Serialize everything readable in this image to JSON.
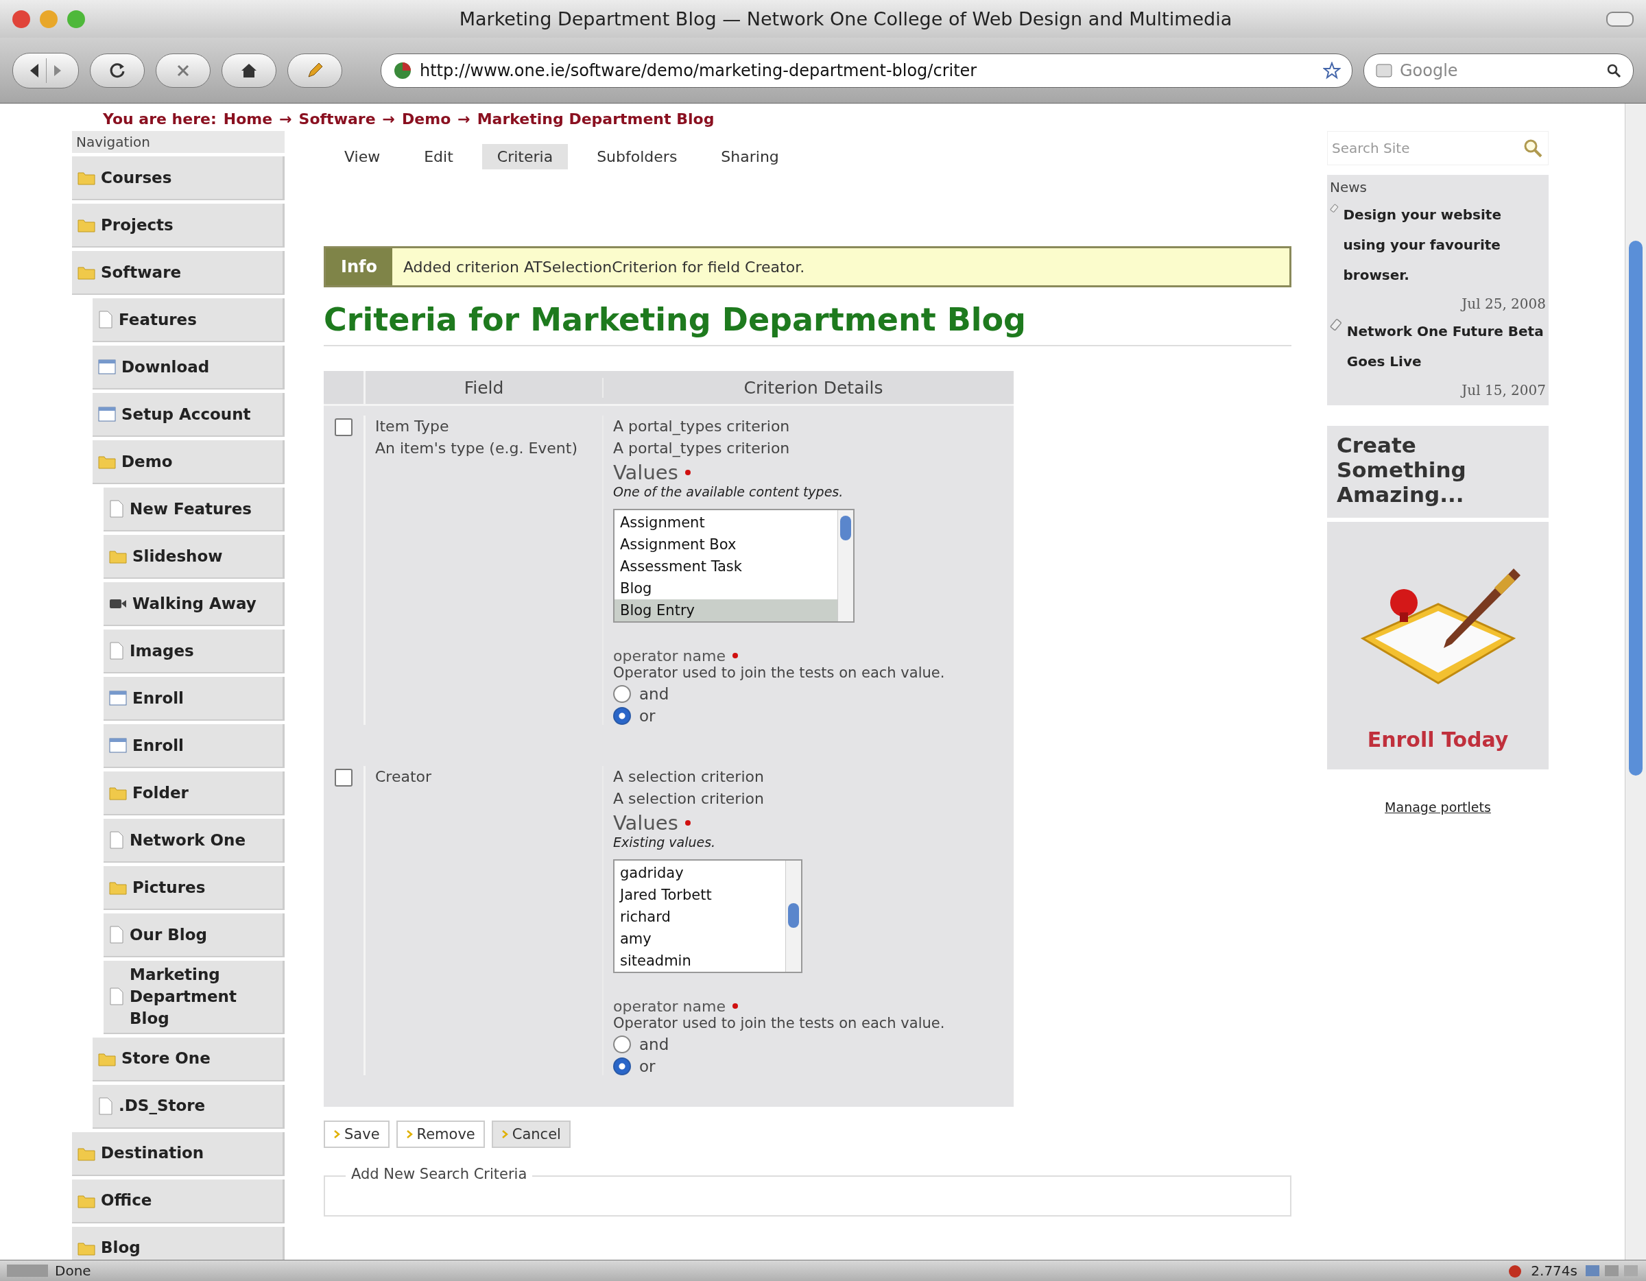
{
  "window": {
    "title": "Marketing Department Blog — Network One College of Web Design and Multimedia"
  },
  "toolbar": {
    "url": "http://www.one.ie/software/demo/marketing-department-blog/criter",
    "search_placeholder": "Google"
  },
  "breadcrumb": {
    "label": "You are here:",
    "separator": "→",
    "items": [
      "Home",
      "Software",
      "Demo",
      "Marketing Department Blog"
    ]
  },
  "navigation": {
    "title": "Navigation",
    "items": [
      {
        "label": "Courses",
        "kind": "folder"
      },
      {
        "label": "Projects",
        "kind": "folder"
      },
      {
        "label": "Software",
        "kind": "folder",
        "children": [
          {
            "label": "Features",
            "kind": "page"
          },
          {
            "label": "Download",
            "kind": "window"
          },
          {
            "label": "Setup Account",
            "kind": "window"
          },
          {
            "label": "Demo",
            "kind": "folder",
            "children": [
              {
                "label": "New Features",
                "kind": "page"
              },
              {
                "label": "Slideshow",
                "kind": "folder"
              },
              {
                "label": "Walking Away",
                "kind": "video"
              },
              {
                "label": "Images",
                "kind": "page"
              },
              {
                "label": "Enroll",
                "kind": "window"
              },
              {
                "label": "Enroll",
                "kind": "window"
              },
              {
                "label": "Folder",
                "kind": "folder"
              },
              {
                "label": "Network One",
                "kind": "page"
              },
              {
                "label": "Pictures",
                "kind": "folder"
              },
              {
                "label": "Our Blog",
                "kind": "page"
              },
              {
                "label": "Marketing Department Blog",
                "kind": "page"
              }
            ]
          },
          {
            "label": "Store One",
            "kind": "folder"
          },
          {
            "label": ".DS_Store",
            "kind": "page"
          }
        ]
      },
      {
        "label": "Destination",
        "kind": "folder"
      },
      {
        "label": "Office",
        "kind": "folder"
      },
      {
        "label": "Blog",
        "kind": "folder"
      }
    ]
  },
  "tabs": [
    {
      "label": "View",
      "selected": false
    },
    {
      "label": "Edit",
      "selected": false
    },
    {
      "label": "Criteria",
      "selected": true
    },
    {
      "label": "Subfolders",
      "selected": false
    },
    {
      "label": "Sharing",
      "selected": false
    }
  ],
  "message": {
    "type": "Info",
    "text": "Added criterion ATSelectionCriterion for field Creator."
  },
  "heading": "Criteria for Marketing Department Blog",
  "criteria_table": {
    "columns": [
      "Field",
      "Criterion Details"
    ],
    "rows": [
      {
        "checked": false,
        "field": "Item Type",
        "field_description": "An item's type (e.g. Event)",
        "details": [
          "A portal_types criterion",
          "A portal_types criterion"
        ],
        "values": {
          "label": "Values",
          "description": "One of the available content types.",
          "options": [
            {
              "label": "Assignment",
              "selected": false
            },
            {
              "label": "Assignment Box",
              "selected": false
            },
            {
              "label": "Assessment Task",
              "selected": false
            },
            {
              "label": "Blog",
              "selected": false
            },
            {
              "label": "Blog Entry",
              "selected": true
            }
          ]
        },
        "operator": {
          "label": "operator name",
          "description": "Operator used to join the tests on each value.",
          "options": [
            {
              "label": "and",
              "selected": false
            },
            {
              "label": "or",
              "selected": true
            }
          ]
        }
      },
      {
        "checked": false,
        "field": "Creator",
        "details": [
          "A selection criterion",
          "A selection criterion"
        ],
        "values": {
          "label": "Values",
          "description": "Existing values.",
          "options": [
            {
              "label": "gadriday",
              "selected": false
            },
            {
              "label": "Jared Torbett",
              "selected": false
            },
            {
              "label": "richard",
              "selected": false
            },
            {
              "label": "amy",
              "selected": false
            },
            {
              "label": "siteadmin",
              "selected": false
            }
          ]
        },
        "operator": {
          "label": "operator name",
          "description": "Operator used to join the tests on each value.",
          "options": [
            {
              "label": "and",
              "selected": false
            },
            {
              "label": "or",
              "selected": true
            }
          ]
        }
      }
    ]
  },
  "buttons": [
    "Save",
    "Remove",
    "Cancel"
  ],
  "fieldset": {
    "legend": "Add New Search Criteria"
  },
  "search": {
    "placeholder": "Search Site"
  },
  "news": {
    "title": "News",
    "items": [
      {
        "title": "Design your website using your favourite browser.",
        "date": "Jul 25, 2008"
      },
      {
        "title": "Network One Future Beta Goes Live",
        "date": "Jul 15, 2007"
      }
    ]
  },
  "promo": {
    "title": "Create Something Amazing...",
    "link": "Enroll Today"
  },
  "manage_portlets": "Manage portlets",
  "status_bar": {
    "text": "Done",
    "timing": "2.774s"
  }
}
